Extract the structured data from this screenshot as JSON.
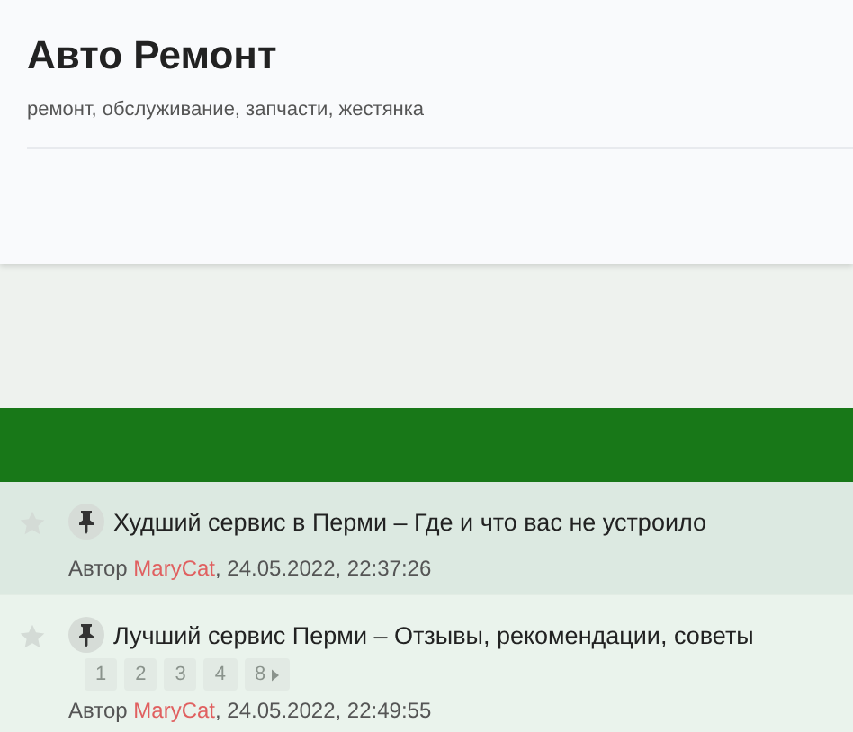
{
  "site": {
    "title": "Авто Ремонт",
    "description": "ремонт, обслуживание, запчасти, жестянка"
  },
  "topics": [
    {
      "title": "Худший сервис в Перми – Где и что вас не устроило",
      "pinned": true,
      "starred": false,
      "highlighted": true,
      "author_prefix": "Автор",
      "author": "MaryCat",
      "date": ", 24.05.2022, 22:37:26"
    },
    {
      "title": "Лучший сервис Перми – Отзывы, рекомендации, советы",
      "pinned": true,
      "starred": false,
      "highlighted": false,
      "pages": [
        {
          "label": "1",
          "kind": "page"
        },
        {
          "label": "2",
          "kind": "page"
        },
        {
          "label": "3",
          "kind": "page"
        },
        {
          "label": "4",
          "kind": "page"
        },
        {
          "label": "8",
          "kind": "last"
        }
      ],
      "author_prefix": "Автор",
      "author": "MaryCat",
      "date": ", 24.05.2022, 22:49:55"
    }
  ]
}
